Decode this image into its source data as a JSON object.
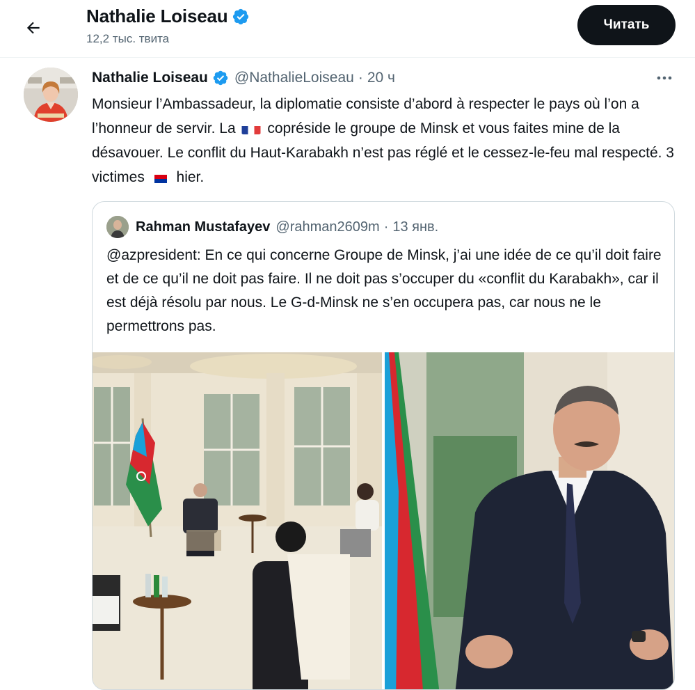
{
  "header": {
    "title": "Nathalie Loiseau",
    "tweet_count": "12,2 тыс. твита",
    "follow_label": "Читать"
  },
  "tweet": {
    "author_name": "Nathalie Loiseau",
    "handle": "@NathalieLoiseau",
    "dot": "·",
    "time": "20 ч",
    "text_part1": "Monsieur l’Ambassadeur, la diplomatie consiste d’abord à respecter le pays où l’on a l’honneur de servir. La",
    "text_part2": "copréside le groupe de Minsk et vous faites mine de la désavouer. Le conflit du Haut-Karabakh n’est pas réglé et le cessez-le-feu mal respecté. 3 victimes",
    "text_part3": "hier."
  },
  "quote": {
    "author_name": "Rahman Mustafayev",
    "handle": "@rahman2609m",
    "dot": "·",
    "time": "13 янв.",
    "text": "@azpresident: En ce qui concerne Groupe de Minsk, j’ai une idée de ce qu’il doit faire et de ce qu’il ne doit pas faire. Il ne doit pas s’occuper du «conflit du Karabakh», car il est déjà résolu par nous. Le G-d-Minsk ne s’en occupera pas, car nous ne le permettrons pas."
  },
  "colors": {
    "text_primary": "#0f1419",
    "text_secondary": "#536471",
    "verified_blue": "#1d9bf0",
    "border": "#cfd9de",
    "button_bg": "#0f1419"
  },
  "icons": [
    "back-arrow-icon",
    "verified-badge-icon",
    "more-icon",
    "france-flag-icon",
    "armenia-flag-icon"
  ]
}
